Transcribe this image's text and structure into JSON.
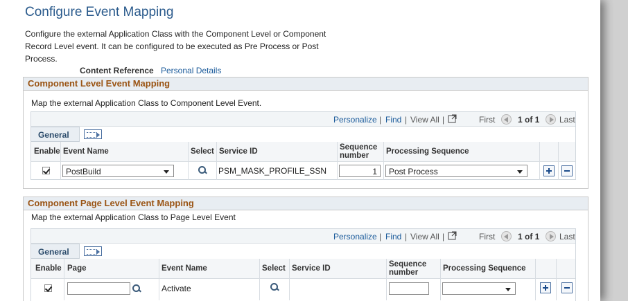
{
  "page": {
    "title": "Configure Event Mapping",
    "description": "Configure the external Application Class with the Component Level or Component Record Level event. It can be configured to be executed as Pre Process or Post Process.",
    "content_reference_label": "Content Reference",
    "content_reference_value": "Personal Details"
  },
  "component_section": {
    "header": "Component Level Event Mapping",
    "description": "Map the external Application Class to Component Level Event.",
    "nav": {
      "personalize": "Personalize",
      "find": "Find",
      "view_all": "View All",
      "first": "First",
      "count": "1 of 1",
      "last": "Last",
      "sep": "|"
    },
    "tab_label": "General",
    "columns": {
      "enable": "Enable",
      "event_name": "Event Name",
      "select": "Select",
      "service_id": "Service ID",
      "seq": "Sequence number",
      "proc_seq": "Processing Sequence"
    },
    "rows": [
      {
        "enabled": true,
        "event_name": "PostBuild",
        "service_id": "PSM_MASK_PROFILE_SSN",
        "sequence": "1",
        "processing_sequence": "Post Process"
      }
    ]
  },
  "page_section": {
    "header": "Component Page Level Event Mapping",
    "description": "Map the external Application Class to Page Level Event",
    "nav": {
      "personalize": "Personalize",
      "find": "Find",
      "view_all": "View All",
      "first": "First",
      "count": "1 of 1",
      "last": "Last",
      "sep": "|"
    },
    "tab_label": "General",
    "columns": {
      "enable": "Enable",
      "page": "Page",
      "event_name": "Event Name",
      "select": "Select",
      "service_id": "Service ID",
      "seq": "Sequence number",
      "proc_seq": "Processing Sequence"
    },
    "rows": [
      {
        "enabled": true,
        "page": "",
        "event_name": "Activate",
        "service_id": "",
        "sequence": "",
        "processing_sequence": ""
      }
    ]
  },
  "colors": {
    "title": "#2a5a8c",
    "section_header": "#9a5414",
    "link": "#1a5a9a"
  }
}
